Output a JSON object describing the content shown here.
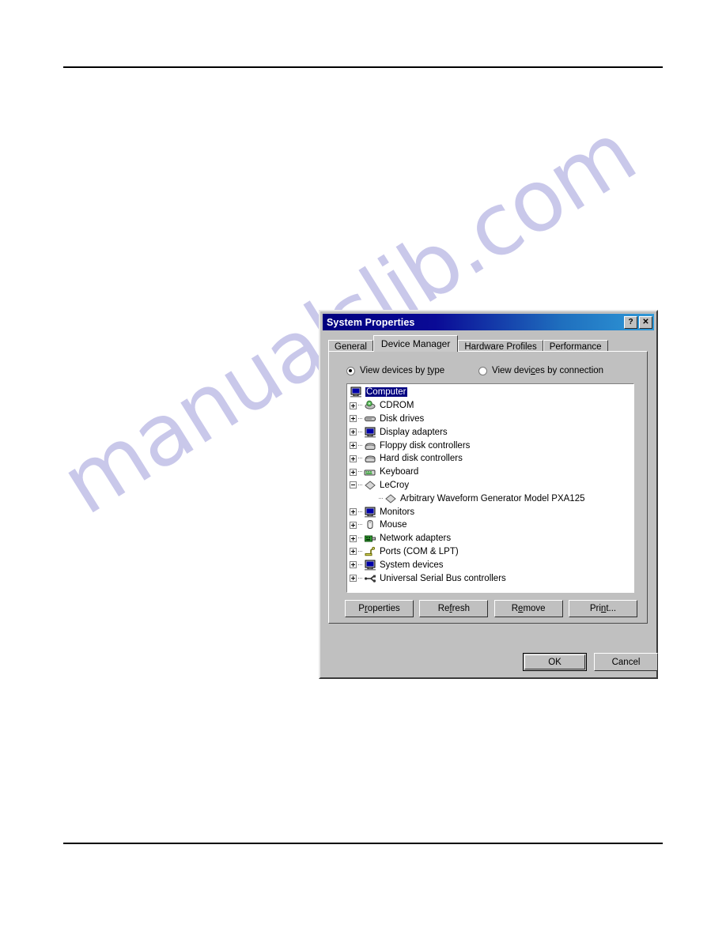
{
  "page": {
    "watermark_text": "manualslib.com",
    "watermark_color": "#c9c8ea"
  },
  "dialog": {
    "title": "System Properties",
    "titlebar_buttons": [
      {
        "name": "help-button",
        "glyph": "?"
      },
      {
        "name": "close-button",
        "glyph": "✕"
      }
    ],
    "tabs": [
      {
        "label": "General",
        "active": false
      },
      {
        "label": "Device Manager",
        "active": true
      },
      {
        "label": "Hardware Profiles",
        "active": false
      },
      {
        "label": "Performance",
        "active": false
      }
    ],
    "view_options": [
      {
        "label": "View devices by type",
        "selected": true
      },
      {
        "label": "View devices by connection",
        "selected": false
      }
    ],
    "device_tree": [
      {
        "label": "Computer",
        "level": 0,
        "expander": "none",
        "icon": "computer-icon",
        "selected": true
      },
      {
        "label": "CDROM",
        "level": 1,
        "expander": "plus",
        "icon": "cdrom-icon",
        "selected": false
      },
      {
        "label": "Disk drives",
        "level": 1,
        "expander": "plus",
        "icon": "disk-drive-icon",
        "selected": false
      },
      {
        "label": "Display adapters",
        "level": 1,
        "expander": "plus",
        "icon": "display-adapter-icon",
        "selected": false
      },
      {
        "label": "Floppy disk controllers",
        "level": 1,
        "expander": "plus",
        "icon": "floppy-controller-icon",
        "selected": false
      },
      {
        "label": "Hard disk controllers",
        "level": 1,
        "expander": "plus",
        "icon": "hard-disk-controller-icon",
        "selected": false
      },
      {
        "label": "Keyboard",
        "level": 1,
        "expander": "plus",
        "icon": "keyboard-icon",
        "selected": false
      },
      {
        "label": "LeCroy",
        "level": 1,
        "expander": "minus",
        "icon": "diamond-icon",
        "selected": false
      },
      {
        "label": "Arbitrary Waveform Generator Model PXA125",
        "level": 2,
        "expander": "none",
        "icon": "diamond-icon",
        "selected": false
      },
      {
        "label": "Monitors",
        "level": 1,
        "expander": "plus",
        "icon": "monitor-icon",
        "selected": false
      },
      {
        "label": "Mouse",
        "level": 1,
        "expander": "plus",
        "icon": "mouse-icon",
        "selected": false
      },
      {
        "label": "Network adapters",
        "level": 1,
        "expander": "plus",
        "icon": "network-adapter-icon",
        "selected": false
      },
      {
        "label": "Ports (COM & LPT)",
        "level": 1,
        "expander": "plus",
        "icon": "port-icon",
        "selected": false
      },
      {
        "label": "System devices",
        "level": 1,
        "expander": "plus",
        "icon": "system-device-icon",
        "selected": false
      },
      {
        "label": "Universal Serial Bus controllers",
        "level": 1,
        "expander": "plus",
        "icon": "usb-icon",
        "selected": false
      }
    ],
    "tree_buttons": [
      {
        "label": "Properties",
        "accel": "r"
      },
      {
        "label": "Refresh",
        "accel": "f"
      },
      {
        "label": "Remove",
        "accel": "e"
      },
      {
        "label": "Print...",
        "accel": "n"
      }
    ],
    "dialog_buttons": [
      {
        "label": "OK",
        "default": true
      },
      {
        "label": "Cancel",
        "default": false
      }
    ],
    "colors": {
      "titlebar_start": "#00007e",
      "titlebar_end": "#2f99d8",
      "face": "#c0c0c0",
      "selection": "#000080",
      "tree_background": "#ffffff"
    }
  }
}
